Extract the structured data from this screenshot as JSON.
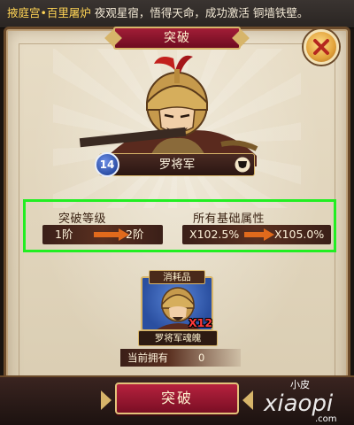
{
  "notice": {
    "prefix": "掖庭宫•百里屠炉",
    "message": " 夜观星宿，悟得天命，成功激活 铜墙铁壁。"
  },
  "dialog": {
    "title": "突破",
    "close_icon": "close-x-icon"
  },
  "general": {
    "level": "14",
    "name": "罗将军",
    "portrait_icon": "general-portrait",
    "shield_icon": "shield-icon"
  },
  "breakthrough": {
    "level_label": "突破等级",
    "from_level": "1阶",
    "to_level": "2阶",
    "attr_label": "所有基础属性",
    "from_attr": "X102.5%",
    "to_attr": "X105.0%",
    "arrow_icon": "arrow-right-icon",
    "highlight_color": "#22ee22"
  },
  "consumable": {
    "title": "消耗品",
    "item_name": "罗将军魂魄",
    "required_count": "X12",
    "owned_label": "当前拥有",
    "owned_value": "0"
  },
  "action": {
    "confirm_label": "突破"
  },
  "watermark": {
    "top": "小皮",
    "main": "xiaopi",
    "sub": ".com"
  },
  "colors": {
    "accent": "#a21d37",
    "gold": "#d7b56a",
    "parchment": "#e8ddc6"
  }
}
